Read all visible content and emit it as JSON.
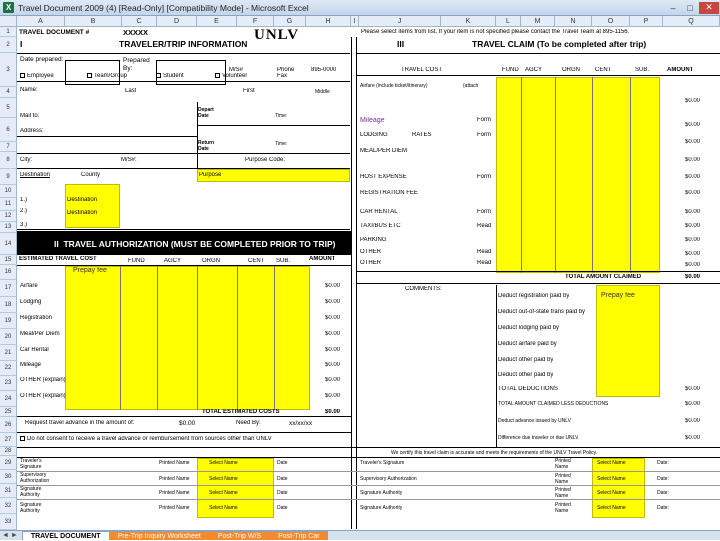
{
  "window": {
    "title": "Travel Document 2009 (4) [Read-Only] [Compatibility Mode] - Microsoft Excel",
    "minimize": "–",
    "maximize": "□",
    "close": "✕",
    "app_icon": "X"
  },
  "columns": [
    "A",
    "B",
    "C",
    "D",
    "E",
    "F",
    "G",
    "H",
    "I",
    "J",
    "K",
    "L",
    "M",
    "N",
    "O",
    "P",
    "Q"
  ],
  "rows": [
    "1",
    "2",
    "3",
    "4",
    "5",
    "6",
    "7",
    "8",
    "9",
    "10",
    "11",
    "12",
    "13",
    "14",
    "15",
    "16",
    "17",
    "18",
    "19",
    "20",
    "21",
    "22",
    "23",
    "24",
    "25",
    "26",
    "27",
    "28",
    "29",
    "30",
    "31",
    "32",
    "33"
  ],
  "header": {
    "travel_document": "TRAVEL DOCUMENT #",
    "doc_number": "XXXXX",
    "logo": "UNLV",
    "instructions": "Please select items from list. If your item is not specified please contact the Travel Team at 895-1156."
  },
  "section1": {
    "numeral": "I",
    "title": "TRAVELER/TRIP INFORMATION",
    "date_prepared": "Date prepared:",
    "prepared_by": "Prepared By:",
    "mail_stop": "M/S#",
    "phone": "Phone",
    "phone_value": "895-0000",
    "employee": "Employee",
    "team_group": "Team/Group",
    "student": "Student",
    "volunteer": "Volunteer",
    "fax": "Fax",
    "name": "Name:",
    "last": "Last",
    "first": "First",
    "middle": "Middle",
    "mail_to": "Mail to:",
    "depart_date": "Depart Date",
    "time": "Time:",
    "address": "Address:",
    "return_date": "Return Date",
    "time2": "Time:",
    "city": "City:",
    "ms2": "M/S#:",
    "purpose_code": "Purpose Code:",
    "destination_label": "Destination",
    "county": "County",
    "purpose": "Purpose",
    "row1": "1.)",
    "row2": "2.)",
    "row3": "3.)",
    "destination": "Destination",
    "destination2": "Destination"
  },
  "section2": {
    "numeral": "II",
    "title": "TRAVEL AUTHORIZATION (MUST BE COMPLETED PRIOR TO TRIP)",
    "headers": [
      "ESTIMATED TRAVEL COST",
      "FUND",
      "AGCY",
      "ORGN",
      "CENT",
      "SUB.",
      "AMOUNT"
    ],
    "prepay": "Prepay fee",
    "items": [
      {
        "label": "Airfare",
        "amount": "$0.00"
      },
      {
        "label": "Lodging",
        "amount": "$0.00"
      },
      {
        "label": "Registration",
        "amount": "$0.00"
      },
      {
        "label": "Meal/Per Diem",
        "amount": "$0.00"
      },
      {
        "label": "Car Rental",
        "amount": "$0.00"
      },
      {
        "label": "Mileage",
        "amount": "$0.00"
      },
      {
        "label": "OTHER (explain)",
        "amount": "$0.00"
      },
      {
        "label": "OTHER (explain)",
        "amount": "$0.00"
      }
    ],
    "total_label": "TOTAL ESTIMATED COSTS",
    "total_value": "$0.00",
    "advance_label": "Request travel advance in the amount of:",
    "advance_value": "$0.00",
    "need_by": "Need By:",
    "need_by_value": "xx/xx/xx",
    "consent": "Do not consent to receive a travel advance or reimbursement from sources other than UNLV"
  },
  "section3": {
    "numeral": "III",
    "title": "TRAVEL CLAIM (To be completed after trip)",
    "headers": [
      "TRAVEL COST",
      "FUND",
      "AGCY",
      "ORGN",
      "CENT",
      "SUB.",
      "AMOUNT"
    ],
    "items": [
      {
        "label": "Airfare (include ticket/itinerary)",
        "extra": "(attach",
        "amount": "$0.00"
      },
      {
        "label": "Mileage",
        "extra": "Form",
        "amount": "$0.00"
      },
      {
        "label": "LODGING",
        "mid": "RATES",
        "extra": "Form",
        "amount": "$0.00"
      },
      {
        "label": "MEAL/PER DIEM",
        "extra": "",
        "amount": "$0.00"
      },
      {
        "label": "HOST EXPENSE",
        "extra": "Form",
        "amount": "$0.00"
      },
      {
        "label": "REGISTRATION FEE",
        "extra": "",
        "amount": "$0.00"
      },
      {
        "label": "CAR RENTAL",
        "extra": "Form",
        "amount": "$0.00"
      },
      {
        "label": "TAXI/BUS ETC",
        "extra": "Read",
        "amount": "$0.00"
      },
      {
        "label": "PARKING",
        "extra": "",
        "amount": "$0.00"
      },
      {
        "label": "OTHER",
        "extra": "Read",
        "amount": "$0.00"
      },
      {
        "label": "OTHER",
        "extra": "Read",
        "amount": "$0.00"
      }
    ],
    "total_claimed_label": "TOTAL AMOUNT CLAIMED",
    "total_claimed_value": "$0.00",
    "comments": "COMMENTS:",
    "deductions": [
      "Deduct registration paid by",
      "Deduct out-of-state trans paid by",
      "Deduct lodging paid by",
      "Deduct airfare paid by",
      "Deduct other paid by",
      "Deduct other paid by"
    ],
    "deduction_prepay": "Prepay fee",
    "total_deductions": "TOTAL DEDUCTIONS",
    "total_deductions_value": "$0.00",
    "amount_claimed_less": "TOTAL AMOUNT CLAIMED LESS DEDUCTIONS",
    "amount_claimed_less_value": "$0.00",
    "advance_issued": "Deduct advance issued by UNLV",
    "advance_issued_value": "$0.00",
    "difference": "Difference due traveler or due UNLV",
    "difference_value": "$0.00",
    "certify": "We certify this travel claim is accurate and meets the requirements of the UNLV Travel Policy."
  },
  "signatures": {
    "left": [
      {
        "label": "Traveler's Signature",
        "printed": "Printed Name",
        "select": "Select Name",
        "date": "Date"
      },
      {
        "label": "Supervisory Authorization",
        "printed": "Printed Name",
        "select": "Select Name",
        "date": "Date"
      },
      {
        "label": "Signature Authority",
        "printed": "Printed Name",
        "select": "Select Name",
        "date": "Date"
      },
      {
        "label": "Signature Authority",
        "printed": "Printed Name",
        "select": "Select Name",
        "date": "Date"
      }
    ],
    "right": [
      {
        "label": "Traveler's Signature",
        "printed": "Printed Name",
        "select": "Select Name",
        "date": "Date:"
      },
      {
        "label": "Supervisory Authorization",
        "printed": "Printed Name",
        "select": "Select Name",
        "date": "Date:"
      },
      {
        "label": "Signature Authority",
        "printed": "Printed Name",
        "select": "Select Name",
        "date": "Date:"
      },
      {
        "label": "Signature Authority",
        "printed": "Printed Name",
        "select": "Select Name",
        "date": "Date:"
      }
    ]
  },
  "sheet_tabs": [
    "TRAVEL DOCUMENT",
    "Pre-Trip Inquiry Worksheet",
    "Post-Trip W/S",
    "Post-Trip Car"
  ],
  "nav": "◄ ►"
}
